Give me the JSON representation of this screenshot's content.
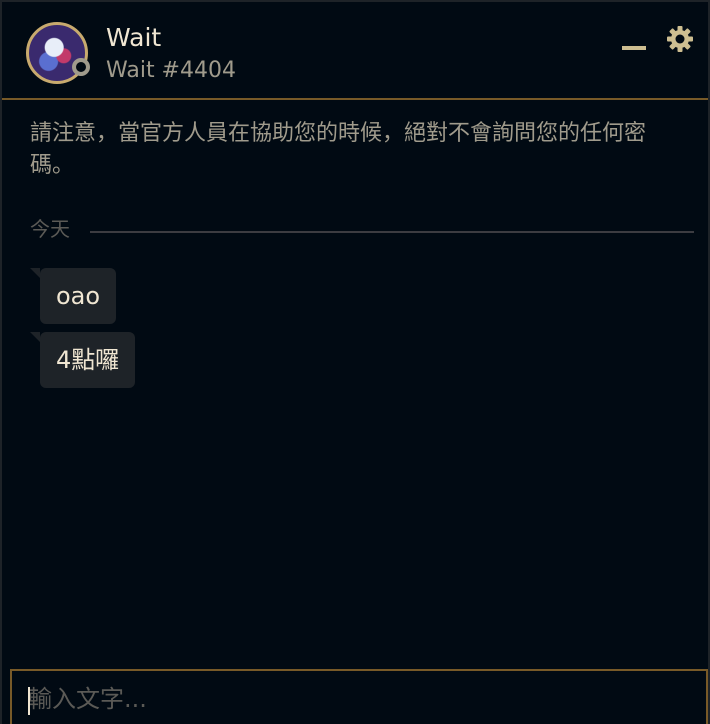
{
  "header": {
    "name": "Wait",
    "tag": "Wait #4404",
    "avatar_icon": "profile-avatar",
    "status_icon": "offline-status-dot",
    "minimize_icon": "minimize-icon",
    "settings_icon": "gear-icon"
  },
  "notice": "請注意，當官方人員在協助您的時候，絕對不會詢問您的任何密碼。",
  "divider": {
    "label": "今天"
  },
  "messages": [
    {
      "text": "oao"
    },
    {
      "text": "4點囉"
    }
  ],
  "input": {
    "placeholder": "輸入文字...",
    "value": ""
  },
  "colors": {
    "background": "#010a13",
    "gold_border": "#785a28",
    "gold_accent": "#c8aa6e",
    "bubble": "#1e2328",
    "text_primary": "#f0e6d2",
    "text_secondary": "#a09b8c"
  }
}
